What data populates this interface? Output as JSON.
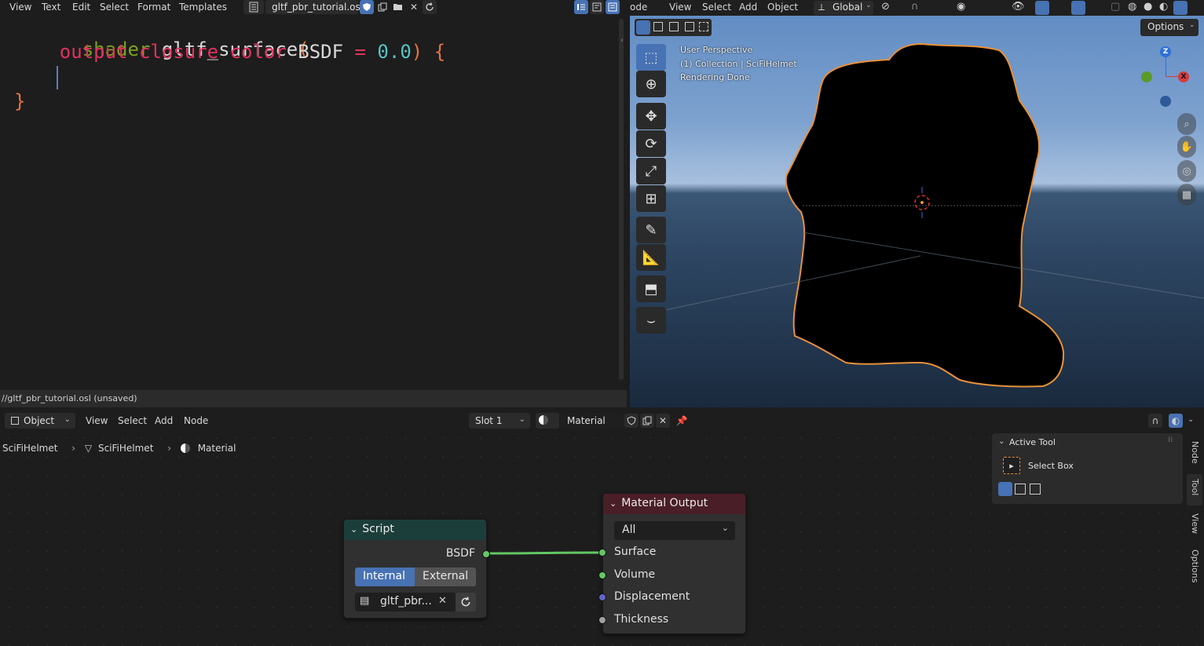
{
  "text_editor": {
    "menu": [
      "View",
      "Text",
      "Edit",
      "Select",
      "Format",
      "Templates"
    ],
    "file_tab": "gltf_pbr_tutorial.osl",
    "code": {
      "line1_kw": "shader",
      "line1_fn": "gltf_surface",
      "line1_paren": "(",
      "line2_a": "output",
      "line2_b": "closure",
      "line2_c": "color",
      "line2_d": "BSDF",
      "line2_eq": "=",
      "line2_num": "0.0",
      "line2_close": ")",
      "line2_brace": "{",
      "line4_brace": "}"
    },
    "status": "//gltf_pbr_tutorial.osl (unsaved)"
  },
  "viewport": {
    "mode_label": "ode",
    "menu": [
      "View",
      "Select",
      "Add",
      "Object"
    ],
    "orientation": "Global",
    "options_label": "Options",
    "info": {
      "line1": "User Perspective",
      "line2": "(1) Collection | SciFiHelmet",
      "line3": "Rendering Done"
    },
    "gizmo": {
      "z": "Z",
      "x": "X"
    }
  },
  "node_editor": {
    "object_mode": "Object",
    "menu": [
      "View",
      "Select",
      "Add",
      "Node"
    ],
    "slot": "Slot 1",
    "material": "Material",
    "breadcrumb": [
      "SciFiHelmet",
      "SciFiHelmet",
      "Material"
    ],
    "script_node": {
      "title": "Script",
      "output": "BSDF",
      "mode_internal": "Internal",
      "mode_external": "External",
      "file": "gltf_pbr..."
    },
    "output_node": {
      "title": "Material Output",
      "target": "All",
      "inputs": [
        "Surface",
        "Volume",
        "Displacement",
        "Thickness"
      ]
    },
    "active_tool_panel": {
      "title": "Active Tool",
      "tool": "Select Box"
    },
    "side_tabs": [
      "Node",
      "Tool",
      "View",
      "Options"
    ]
  },
  "colors": {
    "accent": "#4772b3",
    "selection_outline": "#e8913a",
    "socket_green": "#63c763",
    "socket_purple": "#6363c7",
    "socket_grey": "#a1a1a1",
    "script_header": "#1b3e3a",
    "output_header": "#4a1e26"
  }
}
